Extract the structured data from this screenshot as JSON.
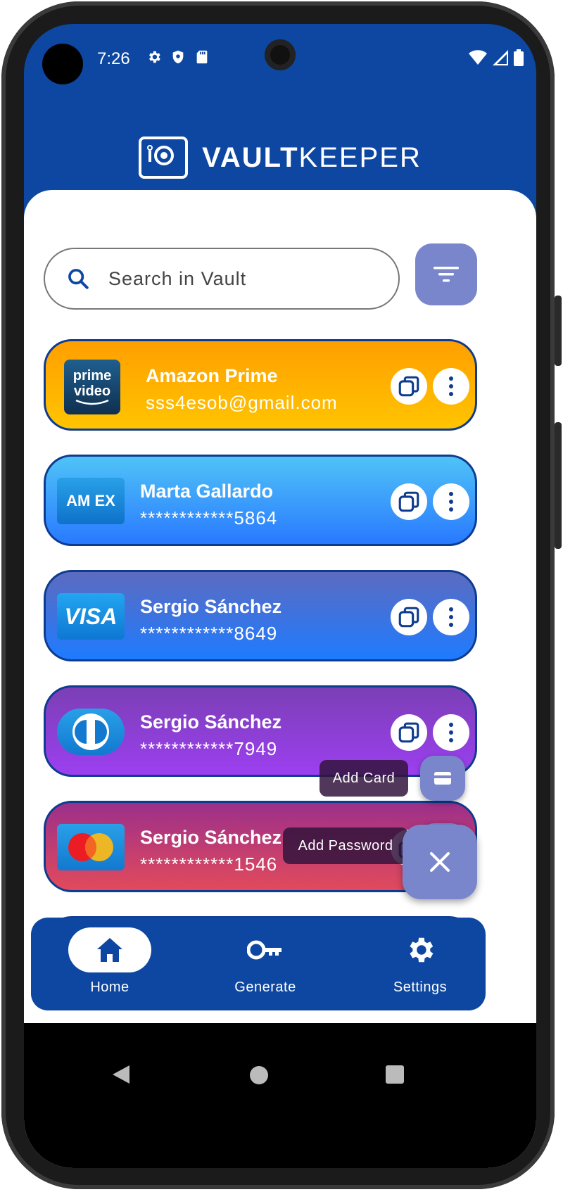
{
  "status_bar": {
    "time": "7:26"
  },
  "app": {
    "name_bold": "VAULT",
    "name_light": "KEEPER"
  },
  "search": {
    "placeholder": "Search in Vault"
  },
  "items": [
    {
      "title": "Amazon Prime",
      "subtitle": "sss4esob@gmail.com",
      "logo": "prime-video-logo",
      "logo_text_1": "prime",
      "logo_text_2": "video"
    },
    {
      "title": "Marta Gallardo",
      "subtitle": "************5864",
      "logo": "amex-logo",
      "logo_text": "AM EX"
    },
    {
      "title": "Sergio Sánchez",
      "subtitle": "************8649",
      "logo": "visa-logo",
      "logo_text": "VISA"
    },
    {
      "title": "Sergio Sánchez",
      "subtitle": "************7949",
      "logo": "diners-logo"
    },
    {
      "title": "Sergio Sánchez",
      "subtitle": "************1546",
      "logo": "mastercard-logo"
    }
  ],
  "fab": {
    "add_card": "Add Card",
    "add_password": "Add Password"
  },
  "bottom_nav": {
    "home": "Home",
    "generate": "Generate",
    "settings": "Settings"
  },
  "colors": {
    "primary": "#0d47a1",
    "accent": "#7986cb"
  }
}
